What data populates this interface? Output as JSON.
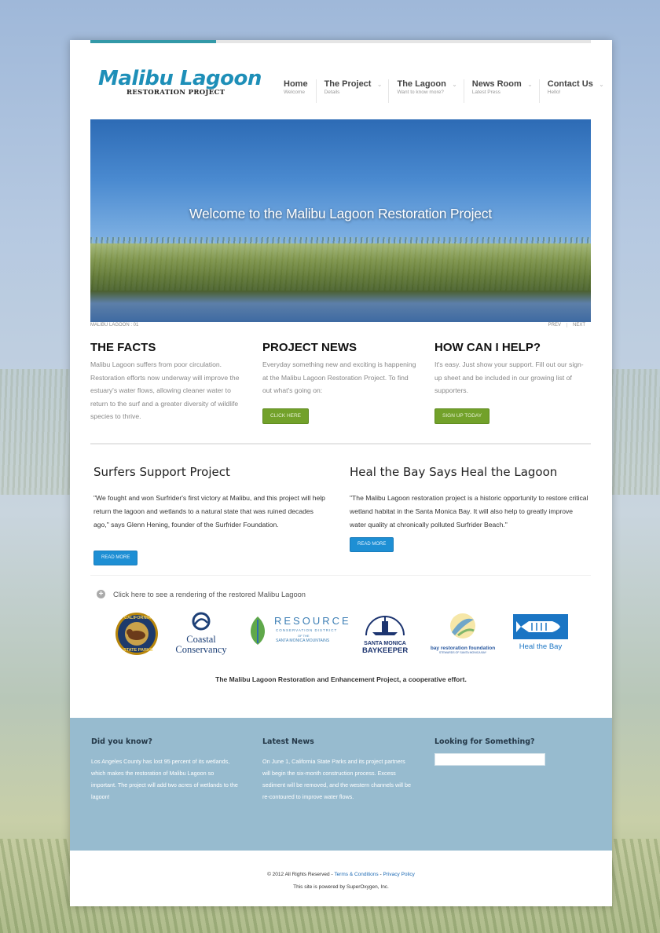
{
  "site": {
    "logo_title": "Malibu Lagoon",
    "logo_subtitle": "RESTORATION PROJECT"
  },
  "nav": [
    {
      "label": "Home",
      "desc": "Welcome"
    },
    {
      "label": "The Project",
      "desc": "Details"
    },
    {
      "label": "The Lagoon",
      "desc": "Want to know more?"
    },
    {
      "label": "News Room",
      "desc": "Latest Press"
    },
    {
      "label": "Contact Us",
      "desc": "Hello!"
    }
  ],
  "hero": {
    "caption": "Welcome to the Malibu Lagoon Restoration Project",
    "slide_label": "MALIBU LAGOON : 01",
    "prev": "PREV",
    "next": "NEXT"
  },
  "columns": [
    {
      "title": "THE FACTS",
      "text": "Malibu Lagoon suffers from poor circulation. Restoration efforts now underway will improve the estuary's water flows, allowing cleaner water to return to the surf and a greater diversity of wildlife species to thrive."
    },
    {
      "title": "PROJECT NEWS",
      "text": "Everyday something new and exciting is happening at the Malibu Lagoon Restoration Project. To find out what's going on:",
      "button": "CLICK HERE"
    },
    {
      "title": "HOW CAN I HELP?",
      "text": "It's easy. Just show your support. Fill out our sign-up sheet and be included in our growing list of supporters.",
      "button": "SIGN UP TODAY"
    }
  ],
  "stories": [
    {
      "title": "Surfers Support Project",
      "text": "\"We fought and won Surfrider's first victory at Malibu, and this project will help return the lagoon and wetlands to a natural state that was ruined decades ago,\" says Glenn Hening, founder of the Surfrider Foundation.",
      "button": "READ MORE"
    },
    {
      "title": "Heal the Bay Says Heal the Lagoon",
      "text": "\"The Malibu Lagoon restoration project is a historic opportunity to restore critical wetland habitat in the Santa Monica Bay. It will also help to greatly improve water quality at chronically polluted Surfrider Beach.\"",
      "button": "READ MORE"
    }
  ],
  "rendering_link": "Click here to see a rendering of the restored Malibu Lagoon",
  "partners": {
    "parks_top": "CALIFORNIA",
    "parks_bottom": "STATE PARKS",
    "coastal_1": "Coastal",
    "coastal_2": "Conservancy",
    "rcd_1": "RESOURCE",
    "rcd_2": "CONSERVATION DISTRICT",
    "rcd_3": "OF THE",
    "rcd_4": "SANTA MONICA MOUNTAINS",
    "bk_1": "SANTA MONICA",
    "bk_2": "BAYKEEPER",
    "brf_1": "bay restoration foundation",
    "brf_2": "STEWARDS OF SANTA MONICA BAY",
    "htb": "Heal the Bay"
  },
  "tagline": "The Malibu Lagoon Restoration and Enhancement Project, a cooperative effort.",
  "footer": {
    "did_you_know_title": "Did you know?",
    "did_you_know_text": "Los Angeles County has lost 95 percent of its wetlands, which makes the restoration of Malibu Lagoon so important. The project will add two acres of wetlands to the lagoon!",
    "latest_news_title": "Latest News",
    "latest_news_text": "On June 1, California State Parks and its project partners will begin the six-month construction process. Excess sediment will be removed, and the western channels will be re-contoured to improve water flows.",
    "search_title": "Looking for Something?"
  },
  "copyright": {
    "prefix": "© 2012 All Rights Reserved - ",
    "terms": "Terms & Conditions",
    "sep": " - ",
    "privacy": "Privacy Policy",
    "powered": "This site is powered by SuperOxygen, Inc."
  }
}
